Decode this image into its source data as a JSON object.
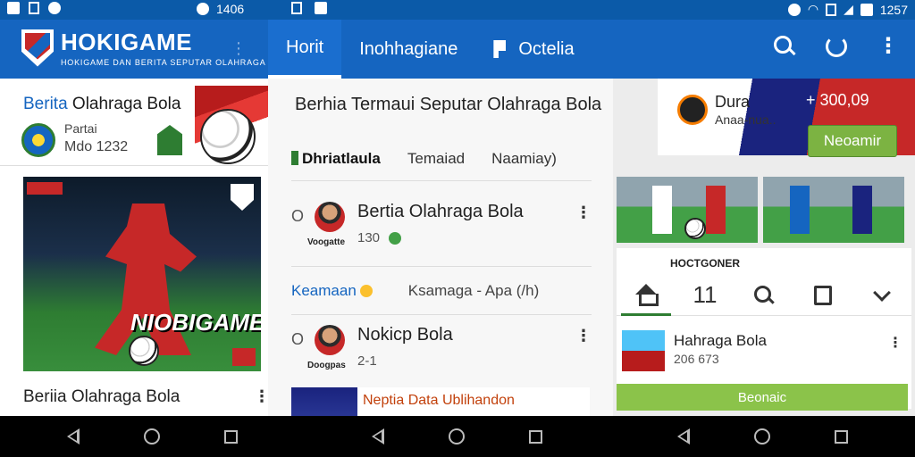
{
  "status_bar": {
    "left_time": "1406",
    "right_time": "1257"
  },
  "app_bar": {
    "brand_title": "HOKIGAME",
    "brand_subtitle": "HOKIGAME DAN BERITA SEPUTAR OLAHRAGA",
    "tabs": [
      {
        "label": "Horit",
        "active": true
      },
      {
        "label": "Inohhagiane",
        "active": false
      },
      {
        "label": "Octelia",
        "active": false
      }
    ]
  },
  "left_column": {
    "promo": {
      "title_prefix": "Berita",
      "title_rest": " Olahraga Bola",
      "line1": "Partai",
      "line2": "Mdo 1232"
    },
    "hero": {
      "title": "NIOBIGAME"
    },
    "caption": "Beriia Olahraga Bola"
  },
  "middle_column": {
    "heading": "Berhia Termaui Seputar Olahraga Bola",
    "subtabs": [
      "Dhriatlaula",
      "Temaiad",
      "Naamiay)"
    ],
    "rows": [
      {
        "num": "O",
        "avatar_label": "Voogatte",
        "title": "Bertia Olahraga Bola",
        "meta": "130"
      },
      {
        "num": "O",
        "avatar_label": "Doogpas",
        "title": "Nokicp Bola",
        "meta": "2-1"
      }
    ],
    "labels": [
      "Keamaan",
      "Ksamaga  -  Apa (/h)"
    ],
    "bottom_card": "Neptia Data Ublihandon"
  },
  "right_column": {
    "promo": {
      "title": "Dura",
      "subtitle": "Anaa-nua..",
      "price": "+ 300,09",
      "button": "Neoamir"
    },
    "sheet": {
      "label": "HOCTGONER",
      "tabs": [
        "home",
        "11",
        "search",
        "box",
        "chevron"
      ],
      "item_title": "Hahraga Bola",
      "item_meta": "206 673",
      "green_bar": "Beonaic"
    }
  },
  "colors": {
    "brand_blue": "#1565c0",
    "accent_green": "#7cb342",
    "brand_red": "#c62828"
  }
}
